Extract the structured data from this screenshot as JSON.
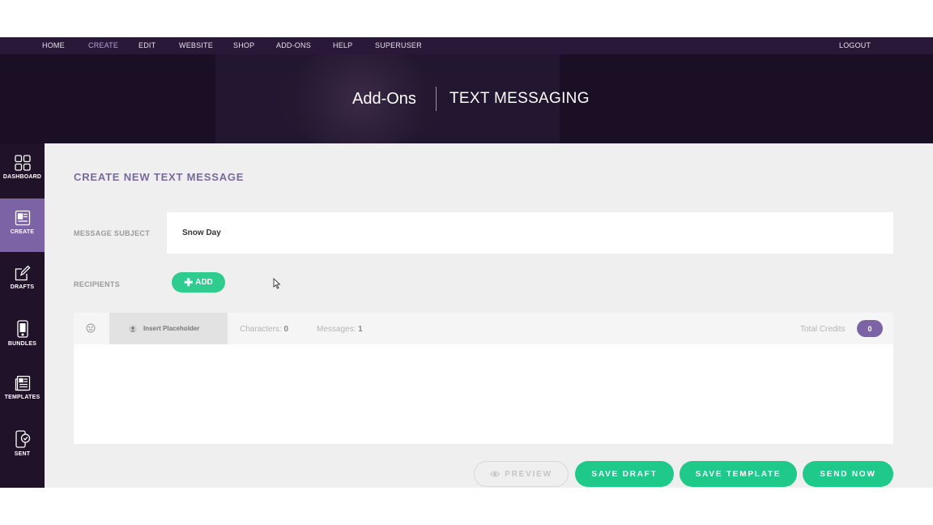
{
  "topnav": {
    "items": [
      "HOME",
      "CREATE",
      "EDIT",
      "WEBSITE",
      "SHOP",
      "ADD-ONS",
      "HELP",
      "SUPERUSER"
    ],
    "logout": "LOGOUT"
  },
  "banner": {
    "title_left": "Add-Ons",
    "title_right": "TEXT MESSAGING"
  },
  "sidebar": {
    "items": [
      {
        "label": "DASHBOARD",
        "icon": "grid-icon"
      },
      {
        "label": "CREATE",
        "icon": "create-icon"
      },
      {
        "label": "DRAFTS",
        "icon": "pencil-icon"
      },
      {
        "label": "BUNDLES",
        "icon": "phone-icon"
      },
      {
        "label": "TEMPLATES",
        "icon": "document-icon"
      },
      {
        "label": "SENT",
        "icon": "sent-icon"
      }
    ]
  },
  "main": {
    "title": "CREATE NEW TEXT MESSAGE",
    "subject_label": "MESSAGE SUBJECT",
    "subject_value": "Snow Day",
    "recipients_label": "RECIPIENTS",
    "add_label": "ADD",
    "composer": {
      "placeholder_button": "Insert Placeholder",
      "characters_label": "Characters:",
      "characters_value": "0",
      "messages_label": "Messages:",
      "messages_value": "1",
      "credits_label": "Total Credits",
      "credits_value": "0"
    },
    "actions": {
      "preview": "PREVIEW",
      "save_draft": "SAVE DRAFT",
      "save_template": "SAVE TEMPLATE",
      "send_now": "SEND NOW"
    }
  },
  "colors": {
    "nav_bg": "#2a1838",
    "banner_bg": "#1a0f24",
    "sidebar_bg": "#1f1229",
    "accent_purple": "#7c63a6",
    "accent_green": "#1fc98a"
  }
}
